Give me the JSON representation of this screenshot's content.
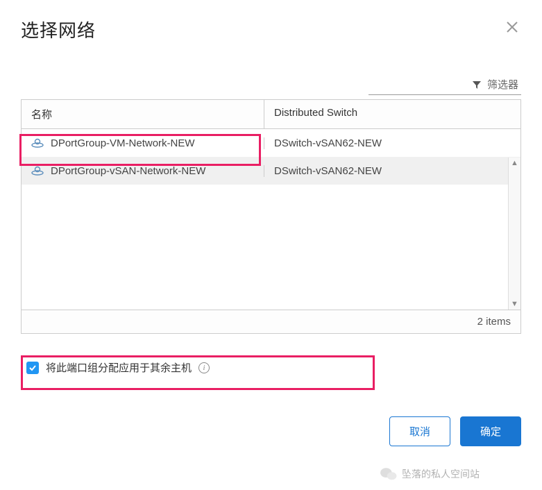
{
  "dialog": {
    "title": "选择网络"
  },
  "filter": {
    "label": "筛选器"
  },
  "table": {
    "columns": {
      "name": "名称",
      "switch": "Distributed Switch"
    },
    "rows": [
      {
        "name": "DPortGroup-VM-Network-NEW",
        "switch": "DSwitch-vSAN62-NEW",
        "selected": false
      },
      {
        "name": "DPortGroup-vSAN-Network-NEW",
        "switch": "DSwitch-vSAN62-NEW",
        "selected": true
      }
    ],
    "item_count": "2 items"
  },
  "checkbox": {
    "label": "将此端口组分配应用于其余主机",
    "checked": true
  },
  "buttons": {
    "cancel": "取消",
    "ok": "确定"
  },
  "watermark": "坠落的私人空间站"
}
